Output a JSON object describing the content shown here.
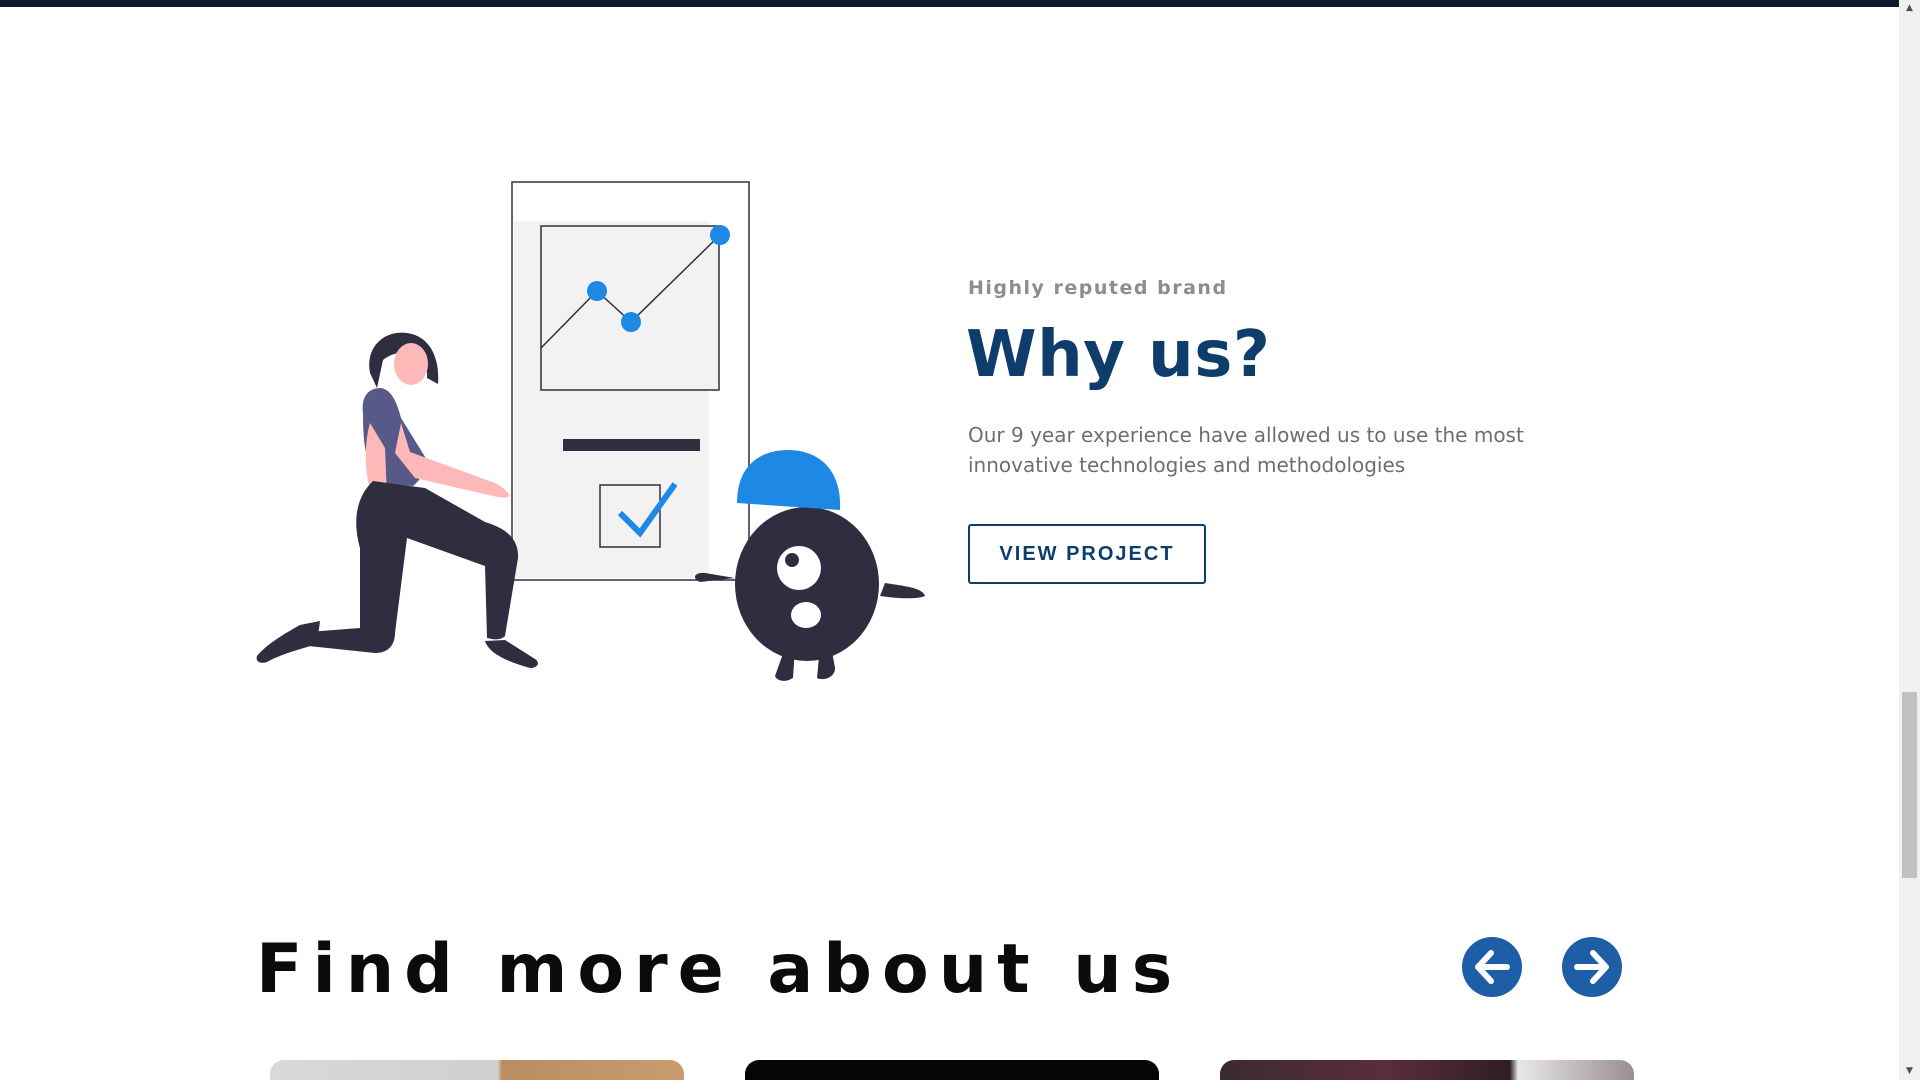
{
  "hero": {
    "eyebrow": "Highly reputed brand",
    "title": "Why us?",
    "description": "Our 9 year experience have allowed us to use the most innovative technologies and methodologies",
    "button_label": "VIEW PROJECT"
  },
  "find_more": {
    "title": "Find more about us",
    "prev_icon": "arrow-left-icon",
    "next_icon": "arrow-right-icon"
  },
  "colors": {
    "accent": "#1e5ea6",
    "title": "#0f3d6b",
    "illustration_blue": "#1e88e5",
    "illustration_dark": "#2f2e41"
  }
}
